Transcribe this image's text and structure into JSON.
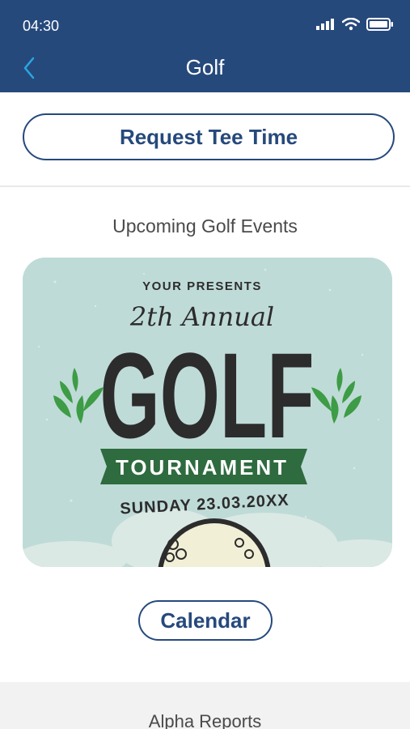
{
  "status": {
    "time": "04:30",
    "icons": [
      "cellular-signal-icon",
      "wifi-icon",
      "battery-icon"
    ]
  },
  "nav": {
    "title": "Golf",
    "back_icon": "chevron-left-icon"
  },
  "request_button": {
    "label": "Request Tee Time"
  },
  "events": {
    "section_title": "Upcoming Golf Events",
    "poster": {
      "presenter": "YOUR PRESENTS",
      "edition": "2th Annual",
      "headline": "GOLF",
      "banner": "TOURNAMENT",
      "date": "SUNDAY 23.03.20XX"
    }
  },
  "calendar_button": {
    "label": "Calendar"
  },
  "reports": {
    "title": "Alpha Reports"
  },
  "colors": {
    "brand": "#26497c",
    "poster_bg": "#bfdbd7",
    "poster_green": "#2e6b3f",
    "leaf_green": "#3d9c45",
    "ink": "#2c2c2c"
  }
}
